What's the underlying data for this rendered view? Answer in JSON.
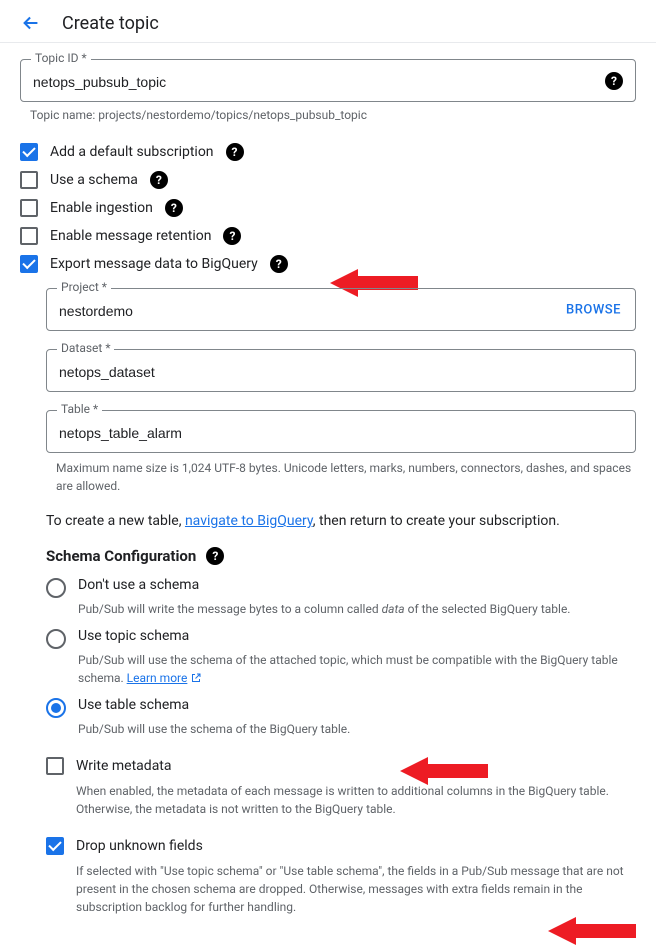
{
  "header": {
    "title": "Create topic"
  },
  "topic": {
    "id_label": "Topic ID *",
    "id_value": "netops_pubsub_topic",
    "name_prefix": "Topic name: projects/nestordemo/topics/netops_pubsub_topic"
  },
  "options": {
    "default_sub": "Add a default subscription",
    "use_schema": "Use a schema",
    "enable_ingestion": "Enable ingestion",
    "enable_retention": "Enable message retention",
    "export_bq": "Export message data to BigQuery"
  },
  "bq": {
    "project_label": "Project *",
    "project_value": "nestordemo",
    "browse": "BROWSE",
    "dataset_label": "Dataset *",
    "dataset_value": "netops_dataset",
    "table_label": "Table *",
    "table_value": "netops_table_alarm",
    "table_help": "Maximum name size is 1,024 UTF-8 bytes. Unicode letters, marks, numbers, connectors, dashes, and spaces are allowed.",
    "create_table_pre": "To create a new table, ",
    "create_table_link": "navigate to BigQuery",
    "create_table_post": ", then return to create your subscription."
  },
  "schema": {
    "heading": "Schema Configuration",
    "r1_label": "Don't use a schema",
    "r1_desc_a": "Pub/Sub will write the message bytes to a column called ",
    "r1_desc_b": "data",
    "r1_desc_c": " of the selected BigQuery table.",
    "r2_label": "Use topic schema",
    "r2_desc": "Pub/Sub will use the schema of the attached topic, which must be compatible with the BigQuery table schema. ",
    "r2_learn": "Learn more",
    "r3_label": "Use table schema",
    "r3_desc": "Pub/Sub will use the schema of the BigQuery table."
  },
  "meta": {
    "write_label": "Write metadata",
    "write_desc": "When enabled, the metadata of each message is written to additional columns in the BigQuery table. Otherwise, the metadata is not written to the BigQuery table.",
    "drop_label": "Drop unknown fields",
    "drop_desc": "If selected with \"Use topic schema\" or \"Use table schema\", the fields in a Pub/Sub message that are not present in the chosen schema are dropped. Otherwise, messages with extra fields remain in the subscription backlog for further handling."
  }
}
